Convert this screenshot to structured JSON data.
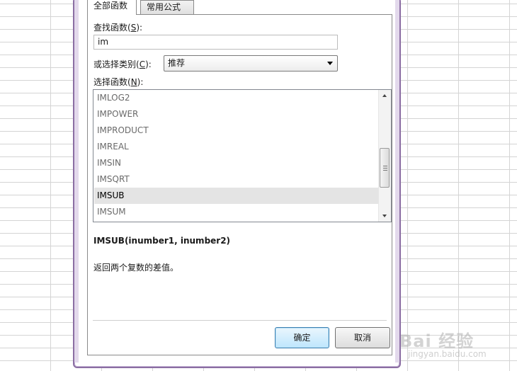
{
  "dialog": {
    "tabs": [
      {
        "label": "全部函数",
        "active": true
      },
      {
        "label": "常用公式",
        "active": false
      }
    ],
    "search": {
      "label": "查找函数(",
      "label_key": "S",
      "label_end": "):",
      "value": "im"
    },
    "category": {
      "label": "或选择类别(",
      "label_key": "C",
      "label_end": "):",
      "selected": "推荐"
    },
    "function_list": {
      "label": "选择函数(",
      "label_key": "N",
      "label_end": "):",
      "items": [
        "IMLOG2",
        "IMPOWER",
        "IMPRODUCT",
        "IMREAL",
        "IMSIN",
        "IMSQRT",
        "IMSUB",
        "IMSUM"
      ],
      "selected": "IMSUB"
    },
    "signature": "IMSUB(inumber1, inumber2)",
    "description": "返回两个复数的差值。",
    "ok_label": "确定",
    "cancel_label": "取消"
  },
  "watermark": {
    "brand": "Bai 经验",
    "sub": "jingyan.baidu.com"
  },
  "colors": {
    "frame": "#8b6ea3",
    "selection": "#e4e4e4",
    "ok_button": "#bee6fd"
  }
}
